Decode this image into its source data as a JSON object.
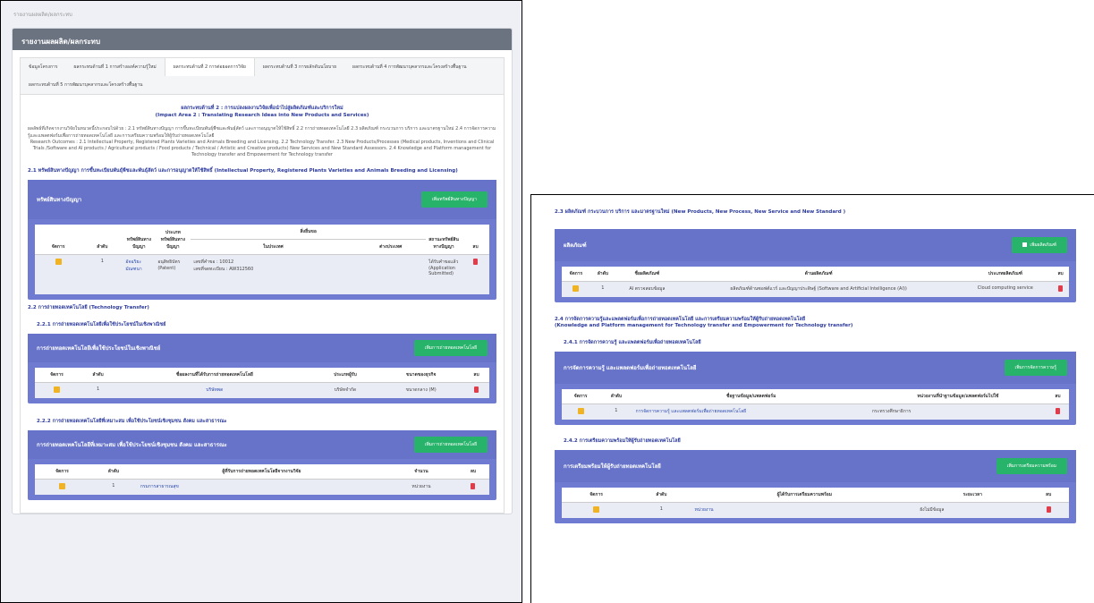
{
  "breadcrumb": "รายงานผลผลิต/ผลกระทบ",
  "card_title": "รายงานผลผลิต/ผลกระทบ",
  "tabs": [
    "ข้อมูลโครงการ",
    "ผลกระทบด้านที่ 1 การสร้างองค์ความรู้ใหม่",
    "ผลกระทบด้านที่ 2 การต่อยอดการวิจัย",
    "ผลกระทบด้านที่ 3 การผลักดันนโยบาย",
    "ผลกระทบด้านที่ 4 การพัฒนาบุคลากรและโครงสร้างพื้นฐาน",
    "ผลกระทบด้านที่ 5 การพัฒนาบุคลากรและโครงสร้างพื้นฐาน"
  ],
  "impact": {
    "title_th": "ผลกระทบด้านที่ 2 : การแปลงผลงานวิจัยเพื่อนำไปสู่ผลิตภัณฑ์และบริการใหม่",
    "title_en": "(Impact Area 2 : Translating Research Ideas into New Products and Services)",
    "desc_th": "ผลลัพธ์ที่เกิดจากงานวิจัยในหมวดนี้ประกอบไปด้วย : 2.1 ทรัพย์สินทางปัญญา การขึ้นทะเบียนพันธุ์พืชและพันธุ์สัตว์ และการอนุญาตให้ใช้สิทธิ์ 2.2 การถ่ายทอดเทคโนโลยี 2.3 ผลิตภัณฑ์ กระบวนการ บริการ และมาตรฐานใหม่ 2.4 การจัดการความรู้และแพลตฟอร์มเพื่อการถ่ายทอดเทคโนโลยี และการเตรียมความพร้อมให้ผู้รับถ่ายทอดเทคโนโลยี",
    "desc_en": "Research Outcomes : 2.1 Intellectual Property, Registered Plants Varieties and Animals Breeding and Licensing. 2.2 Technology Transfer. 2.3 New Products/Processes (Medical products, Inventions and Clinical Trials /Software and AI products / Agricultural products / Food products / Technical / Artistic and Creative products) New Services and New Standard Assessors. 2.4 Knowledge and Platform management for Technology transfer and Empowerment for Technology transfer"
  },
  "s21": {
    "heading": "2.1 ทรัพย์สินทางปัญญา การขึ้นทะเบียนพันธุ์พืชและพันธุ์สัตว์ และการอนุญาตให้ใช้สิทธิ์ (Intellectual Property, Registered Plants Varieties and Animals Breeding and Licensing)",
    "panel_title": "ทรัพย์สินทางปัญญา",
    "button": "เพิ่มทรัพย์สินทางปัญญา",
    "headers": [
      "จัดการ",
      "ลำดับ",
      "ทรัพย์สินทางปัญญา",
      "ประเภททรัพย์สินทางปัญญา",
      "ในประเทศ",
      "ต่างประเทศ",
      "สถานะทรัพย์สินทางปัญญา",
      "ลบ"
    ],
    "group_header": "สิ่งยื่นขอ",
    "row": {
      "no": "1",
      "ip": "อัจฉริยะ มัณฑนา",
      "type": "อนุสิทธิบัตร (Patent)",
      "domestic_1": "เลขที่คำขอ : 10012",
      "domestic_2": "เลขที่จดทะเบียน : AW312560",
      "foreign": "",
      "status": "ได้รับคำขอแล้ว (Application Submitted)"
    }
  },
  "s22": {
    "heading": "2.2 การถ่ายทอดเทคโนโลยี (Technology Transfer)",
    "sub1": "2.2.1 การถ่ายทอดเทคโนโลยีเพื่อใช้ประโยชน์ในเชิงพาณิชย์",
    "panel1_title": "การถ่ายทอดเทคโนโลยีเพื่อใช้ประโยชน์ในเชิงพาณิชย์",
    "button1": "เพิ่มการถ่ายทอดเทคโนโลยี",
    "headers1": [
      "จัดการ",
      "ลำดับ",
      "ชื่อผลงานที่ได้รับการถ่ายทอดเทคโนโลยี",
      "ประเภทผู้รับ",
      "ขนาดของธุรกิจ",
      "ลบ"
    ],
    "row1": {
      "no": "1",
      "name": "บริษัทพด",
      "type": "บริษัทจำกัด",
      "size": "ขนาดกลาง (M)"
    },
    "sub2": "2.2.2 การถ่ายทอดเทคโนโลยีที่เหมาะสม เพื่อใช้ประโยชน์เชิงชุมชน สังคม และสาธารณะ",
    "panel2_title": "การถ่ายทอดเทคโนโลยีที่เหมาะสม เพื่อใช้ประโยชน์เชิงชุมชน สังคม และสาธารณะ",
    "button2": "เพิ่มการถ่ายทอดเทคโนโลยี",
    "headers2": [
      "จัดการ",
      "ลำดับ",
      "ผู้ที่รับการถ่ายทอดเทคโนโลยีจากงานวิจัย",
      "จำนวน",
      "ลบ"
    ],
    "row2": {
      "no": "1",
      "name": "กรมการสาธารณสุข",
      "count": "หน่วยงาน"
    }
  },
  "s23": {
    "heading": "2.3 ผลิตภัณฑ์ กระบวนการ บริการ และมาตรฐานใหม่ (New Products, New Process, New Service and New Standard )",
    "panel_title": "ผลิตภัณฑ์",
    "button": "เพิ่มผลิตภัณฑ์",
    "headers": [
      "จัดการ",
      "ลำดับ",
      "ชื่อผลิตภัณฑ์",
      "ด้านผลิตภัณฑ์",
      "ประเภทผลิตภัณฑ์",
      "ลบ"
    ],
    "row": {
      "no": "1",
      "name": "AI ตรวจสอบข้อมูล",
      "area": "ผลิตภัณฑ์ด้านซอฟต์แวร์ และปัญญาประดิษฐ์ (Software and Artificial Intelligence (AI))",
      "type": "Cloud computing service"
    }
  },
  "s24": {
    "heading_1": "2.4 การจัดการความรู้และแพลตฟอร์มเพื่อการถ่ายทอดเทคโนโลยี และการเตรียมความพร้อมให้ผู้รับถ่ายทอดเทคโนโลยี",
    "heading_2": "(Knowledge and Platform management for Technology transfer and Empowerment for Technology transfer)",
    "sub1": "2.4.1 การจัดการความรู้ และแพลตฟอร์มเพื่อถ่ายทอดเทคโนโลยี",
    "panel1_title": "การจัดการความรู้ และแพลตฟอร์มเพื่อถ่ายทอดเทคโนโลยี",
    "button1": "เพิ่มการจัดการความรู้",
    "headers1": [
      "จัดการ",
      "ลำดับ",
      "ชื่อฐานข้อมูล/แพลตฟอร์ม",
      "หน่วยงานที่นำฐานข้อมูล/แพลตฟอร์มไปใช้",
      "ลบ"
    ],
    "row1": {
      "no": "1",
      "name": "การจัดการความรู้ และแพลตฟอร์มเพื่อถ่ายทอดเทคโนโลยี",
      "agency": "กระทรวงศึกษาธิการ"
    },
    "sub2": "2.4.2 การเตรียมความพร้อมให้ผู้รับถ่ายทอดเทคโนโลยี",
    "panel2_title": "การเตรียมพร้อมให้ผู้รับถ่ายทอดเทคโนโลยี",
    "button2": "เพิ่มการเตรียมความพร้อม",
    "headers2": [
      "จัดการ",
      "ลำดับ",
      "ผู้ได้รับการเตรียมความพร้อม",
      "ระยะเวลา",
      "ลบ"
    ],
    "row2": {
      "no": "1",
      "name": "หน่วยงาน",
      "period": "ยังไม่มีข้อมูล"
    }
  },
  "colors": {
    "header_gray": "#6b7280",
    "panel_blue": "#6673c9",
    "button_green": "#27b36a",
    "heading_blue": "#2b3a9c",
    "edit_orange": "#f0b323",
    "delete_red": "#e23b4a"
  },
  "icons": {
    "edit": "edit-icon",
    "delete": "trash-icon",
    "add": "plus-icon"
  }
}
